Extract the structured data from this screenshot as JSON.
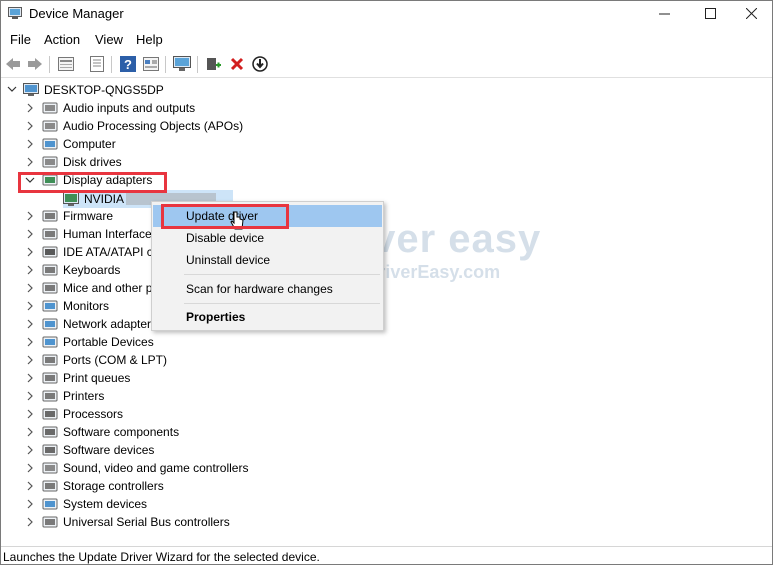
{
  "window": {
    "title": "Device Manager"
  },
  "menu": [
    "File",
    "Action",
    "View",
    "Help"
  ],
  "toolbar": {
    "icons": [
      "back-arrow-icon",
      "forward-arrow-icon",
      "properties-icon",
      "list-icon",
      "help-icon",
      "grid-icon",
      "monitor-scan-icon",
      "add-driver-icon",
      "remove-x-icon",
      "download-circle-icon"
    ]
  },
  "tree": {
    "root": "DESKTOP-QNGS5DP",
    "categories": [
      "Audio inputs and outputs",
      "Audio Processing Objects (APOs)",
      "Computer",
      "Disk drives",
      "Display adapters",
      "Firmware",
      "Human Interface",
      "IDE ATA/ATAPI co",
      "Keyboards",
      "Mice and other p",
      "Monitors",
      "Network adapter",
      "Portable Devices",
      "Ports (COM & LPT)",
      "Print queues",
      "Printers",
      "Processors",
      "Software components",
      "Software devices",
      "Sound, video and game controllers",
      "Storage controllers",
      "System devices",
      "Universal Serial Bus controllers"
    ],
    "expanded_child": "NVIDIA"
  },
  "context_menu": {
    "update": "Update driver",
    "disable": "Disable device",
    "uninstall": "Uninstall device",
    "scan": "Scan for hardware changes",
    "properties": "Properties"
  },
  "watermark": {
    "brand": "driver easy",
    "url": "www.DriverEasy.com"
  },
  "status": "Launches the Update Driver Wizard for the selected device.",
  "colors": {
    "highlight": "#9ec7f0",
    "annotation_red": "#e8353f"
  }
}
